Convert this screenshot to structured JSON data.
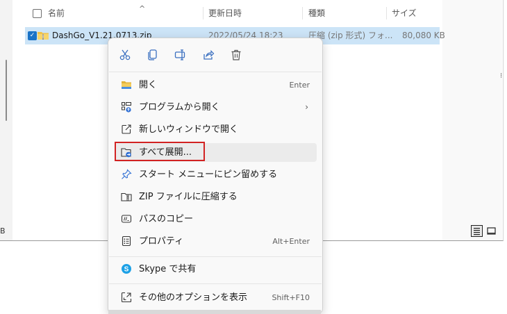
{
  "explorer": {
    "left_edge_text": "B",
    "columns": {
      "name": "名前",
      "modified": "更新日時",
      "type": "種類",
      "size": "サイズ"
    },
    "file": {
      "name": "DashGo_V1.21.0713.zip",
      "modified": "2022/05/24 18:23",
      "type": "圧縮 (zip 形式) フォ...",
      "size": "80,080 KB"
    }
  },
  "context_menu": {
    "quick_actions": [
      "cut-icon",
      "copy-icon",
      "rename-icon",
      "share-icon",
      "delete-icon"
    ],
    "items": [
      {
        "label": "開く",
        "shortcut": "Enter",
        "icon": "folder-icon"
      },
      {
        "label": "プログラムから開く",
        "shortcut": "",
        "icon": "open-with-icon",
        "submenu_arrow": "›"
      },
      {
        "label": "新しいウィンドウで開く",
        "shortcut": "",
        "icon": "new-window-icon"
      },
      {
        "label": "すべて展開...",
        "shortcut": "",
        "icon": "extract-icon"
      },
      {
        "label": "スタート メニューにピン留めする",
        "shortcut": "",
        "icon": "pin-icon"
      },
      {
        "label": "ZIP ファイルに圧縮する",
        "shortcut": "",
        "icon": "zip-compress-icon"
      },
      {
        "label": "パスのコピー",
        "shortcut": "",
        "icon": "copy-path-icon"
      },
      {
        "label": "プロパティ",
        "shortcut": "Alt+Enter",
        "icon": "properties-icon"
      },
      {
        "label": "Skype で共有",
        "shortcut": "",
        "icon": "skype-icon"
      },
      {
        "label": "その他のオプションを表示",
        "shortcut": "Shift+F10",
        "icon": "more-options-icon"
      }
    ]
  },
  "colors": {
    "selection": "#cce4f7",
    "highlight_box": "#d22222",
    "checkbox_checked": "#1a73c7",
    "skype": "#1da1e6"
  }
}
